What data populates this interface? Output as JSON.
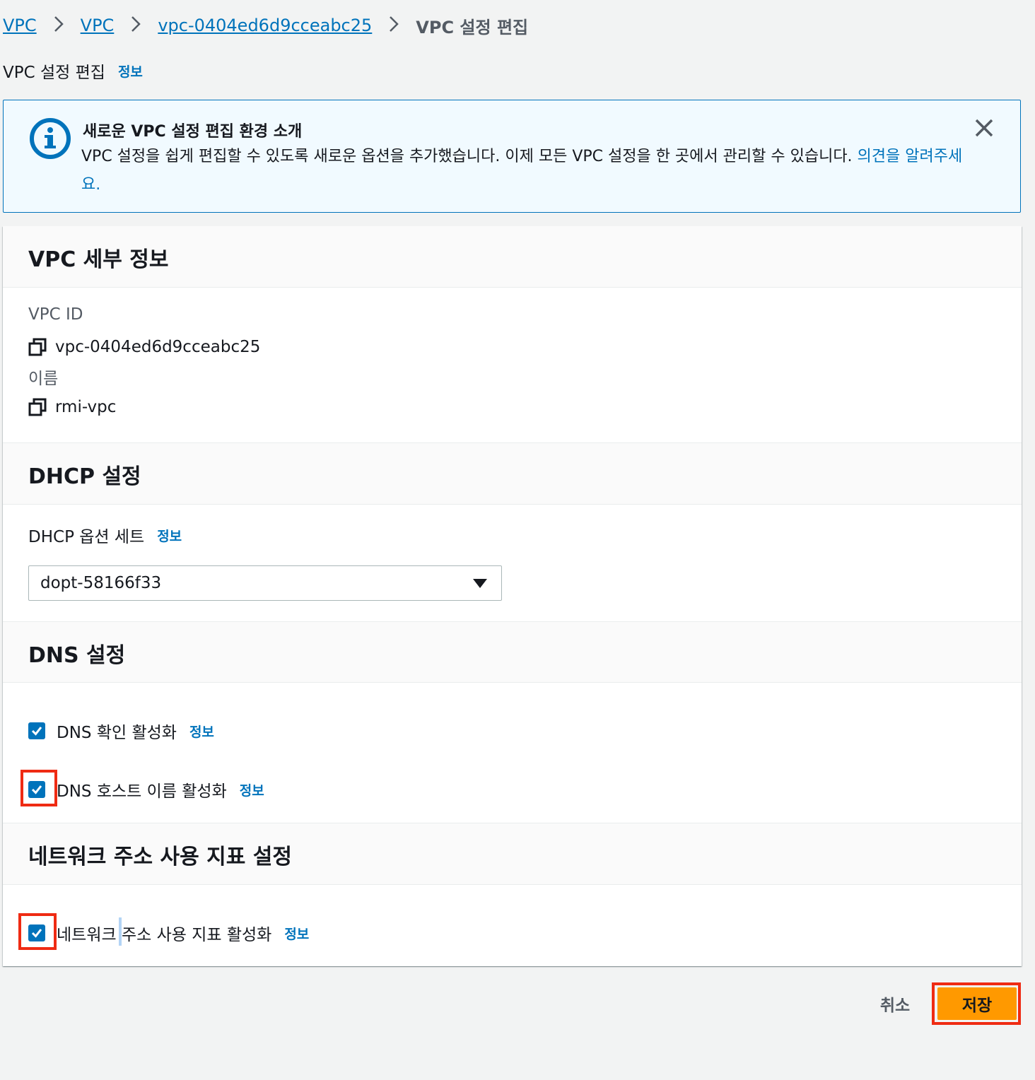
{
  "breadcrumb": {
    "items": [
      "VPC",
      "VPC",
      "vpc-0404ed6d9cceabc25"
    ],
    "current": "VPC 설정 편집"
  },
  "page": {
    "title": "VPC 설정 편집",
    "info": "정보"
  },
  "flash": {
    "title": "새로운 VPC 설정 편집 환경 소개",
    "body": "VPC 설정을 쉽게 편집할 수 있도록 새로운 옵션을 추가했습니다. 이제 모든 VPC 설정을 한 곳에서 관리할 수 있습니다. ",
    "link": "의견을 알려주세요."
  },
  "details": {
    "header": "VPC 세부 정보",
    "vpc_id_label": "VPC ID",
    "vpc_id": "vpc-0404ed6d9cceabc25",
    "name_label": "이름",
    "name": "rmi-vpc"
  },
  "dhcp": {
    "header": "DHCP 설정",
    "label": "DHCP 옵션 세트",
    "info": "정보",
    "selected": "dopt-58166f33"
  },
  "dns": {
    "header": "DNS 설정",
    "resolution_label": "DNS 확인 활성화",
    "resolution_checked": true,
    "hostnames_label": "DNS 호스트 이름 활성화",
    "hostnames_checked": true,
    "info": "정보"
  },
  "network_usage": {
    "header": "네트워크 주소 사용 지표 설정",
    "label": "네트워크 주소 사용 지표 활성화",
    "checked": true,
    "info": "정보"
  },
  "footer": {
    "cancel": "취소",
    "save": "저장"
  },
  "colors": {
    "link": "#0073bb",
    "primary_button": "#ff9900",
    "highlight": "#ef2b13",
    "flash_bg": "#f1faff"
  }
}
